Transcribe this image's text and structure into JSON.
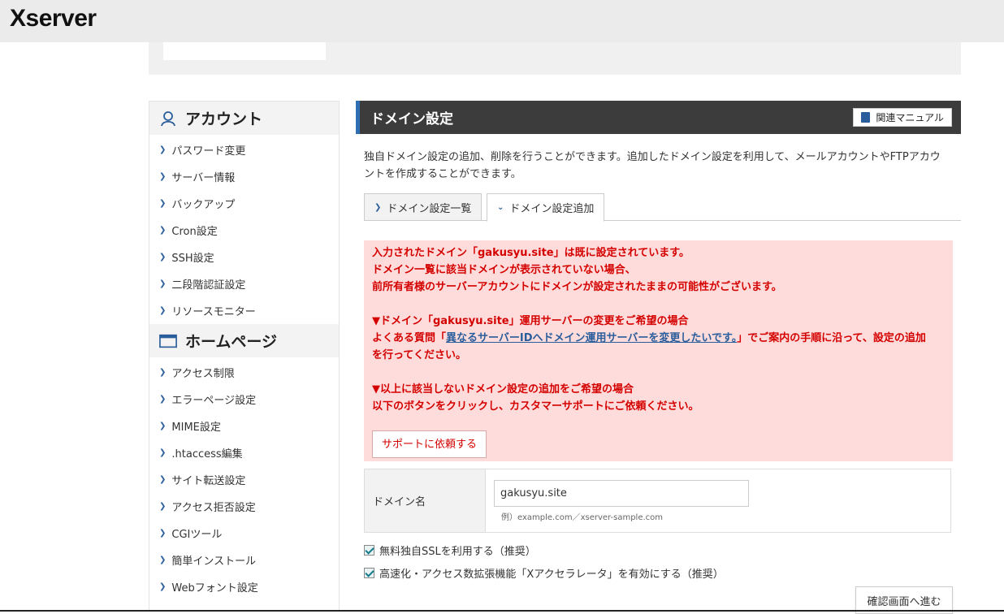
{
  "header": {
    "logo": "Xserver"
  },
  "sidebar": {
    "sections": [
      {
        "title": "アカウント",
        "items": [
          "パスワード変更",
          "サーバー情報",
          "バックアップ",
          "Cron設定",
          "SSH設定",
          "二段階認証設定",
          "リソースモニター"
        ]
      },
      {
        "title": "ホームページ",
        "items": [
          "アクセス制限",
          "エラーページ設定",
          "MIME設定",
          ".htaccess編集",
          "サイト転送設定",
          "アクセス拒否設定",
          "CGIツール",
          "簡単インストール",
          "Webフォント設定"
        ]
      }
    ]
  },
  "main": {
    "title": "ドメイン設定",
    "manual_button": "関連マニュアル",
    "description_line1": "独自ドメイン設定の追加、削除を行うことができます。追加したドメイン設定を利用して、メールアカウントやFTPアカウ",
    "description_line2": "ントを作成することができます。",
    "tabs": [
      "ドメイン設定一覧",
      "ドメイン設定追加"
    ],
    "alert": {
      "line1": "入力されたドメイン「gakusyu.site」は既に設定されています。",
      "line2": "ドメイン一覧に該当ドメインが表示されていない場合、",
      "line3": "前所有者様のサーバーアカウントにドメインが設定されたままの可能性がございます。",
      "line4": "▼ドメイン「gakusyu.site」運用サーバーの変更をご希望の場合",
      "line5_pre": "よくある質問「",
      "line5_link": "異なるサーバーIDへドメイン運用サーバーを変更したいです。",
      "line5_post": "」でご案内の手順に沿って、設定の追加",
      "line6": "を行ってください。",
      "line7": "▼以上に該当しないドメイン設定の追加をご希望の場合",
      "line8": "以下のボタンをクリックし、カスタマーサポートにご依頼ください。",
      "support_button": "サポートに依頼する"
    },
    "form": {
      "domain_label": "ドメイン名",
      "domain_value": "gakusyu.site",
      "example": "例）example.com／xserver-sample.com"
    },
    "options": {
      "ssl_label": "無料独自SSLを利用する（推奨）",
      "accelerator_label": "高速化・アクセス数拡張機能「Xアクセラレータ」を有効にする（推奨）"
    },
    "confirm_button": "確認画面へ進む"
  },
  "colors": {
    "accent": "#2f6eb3",
    "alert_bg": "#ffdcdc",
    "alert_text": "#d40000",
    "title_bar": "#3c3c3c"
  }
}
